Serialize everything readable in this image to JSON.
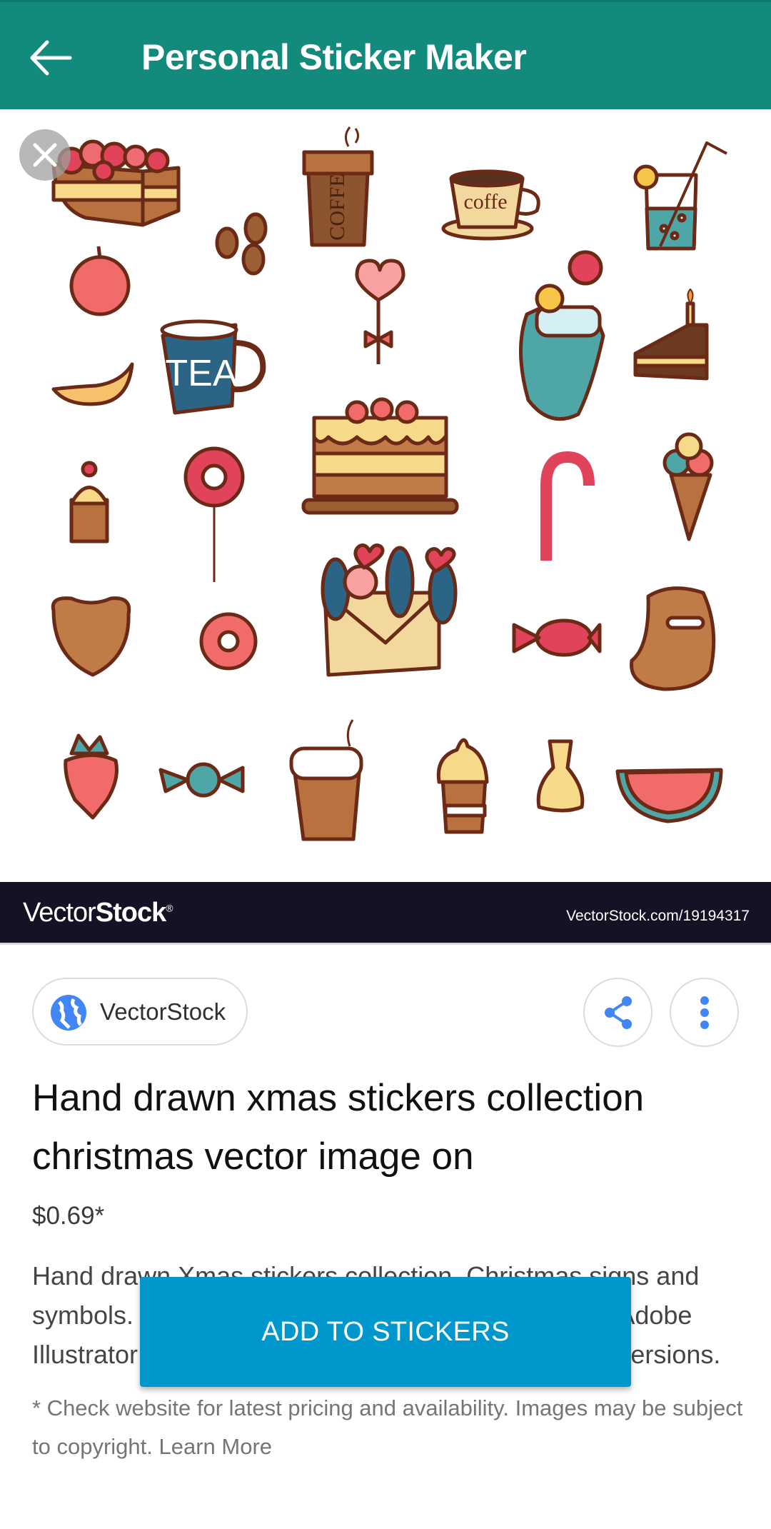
{
  "appbar": {
    "title": "Personal Sticker Maker",
    "back_icon": "arrow-left-icon",
    "color": "#138b7c"
  },
  "image": {
    "close_icon": "close-icon",
    "description": "Hand drawn sweets and drinks sticker sheet",
    "watermark_brand_light": "Vector",
    "watermark_brand_bold": "Stock",
    "watermark_reg": "®",
    "watermark_url": "VectorStock.com/19194317",
    "stickers": [
      "cake-slice",
      "coffee-cup-togo",
      "coffee-cup-saucer",
      "lemonade-glass",
      "coffee-beans",
      "apple",
      "heart-lollipop",
      "mitten-with-candy",
      "cake-piece-with-candle",
      "croissant",
      "tea-mug",
      "layer-cake",
      "ice-cream-cup",
      "swirl-lollipop",
      "candy-cane",
      "ice-cream-cone",
      "gingerbread-heart",
      "donut",
      "envelope-bouquet",
      "wrapped-candy-red",
      "gingerbread-stocking",
      "strawberry",
      "wrapped-candy-teal",
      "coffee-cup-takeaway",
      "soft-serve-cup",
      "candy-bag",
      "watermelon-slice"
    ],
    "cup_text_1": "COFFE",
    "cup_text_2": "coffe",
    "mug_text": "TEA"
  },
  "source": {
    "name": "VectorStock",
    "icon": "globe-icon",
    "share_icon": "share-icon",
    "more_icon": "more-vert-icon",
    "accent": "#4285f4"
  },
  "product": {
    "title": "Hand drawn xmas stickers collection christmas vector image on",
    "price": "$0.69*",
    "description": "Hand drawn Xmas stickers collection. Christmas signs and symbols. Download a Free Preview or High Quality Adobe Illustrator Ai, EPS, PDF and High Resolution JPEG versions.",
    "description_visible": "Hand drawn Xmas stickers collection. Christmas signs and symb… Preview or High Q…",
    "disclaimer": "* Check website for latest pricing and availability. Images may be subject to copyright.",
    "learn_more": "Learn More"
  },
  "actions": {
    "add_to_stickers": "ADD TO STICKERS",
    "button_color": "#0098cc"
  }
}
